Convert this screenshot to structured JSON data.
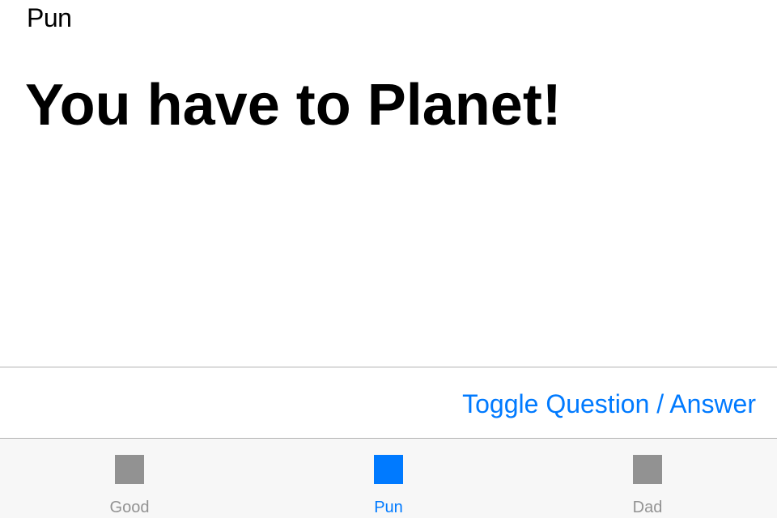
{
  "header": {
    "category": "Pun"
  },
  "main": {
    "joke": "You have to Planet!"
  },
  "actions": {
    "toggle_label": "Toggle Question / Answer"
  },
  "tab_bar": {
    "tabs": [
      {
        "label": "Good",
        "icon": "square-icon",
        "active": false
      },
      {
        "label": "Pun",
        "icon": "square-icon",
        "active": true
      },
      {
        "label": "Dad",
        "icon": "square-icon",
        "active": false
      }
    ]
  },
  "colors": {
    "accent": "#007aff",
    "inactive": "#929292",
    "text": "#000000",
    "tab_bar_bg": "#f7f7f7"
  }
}
